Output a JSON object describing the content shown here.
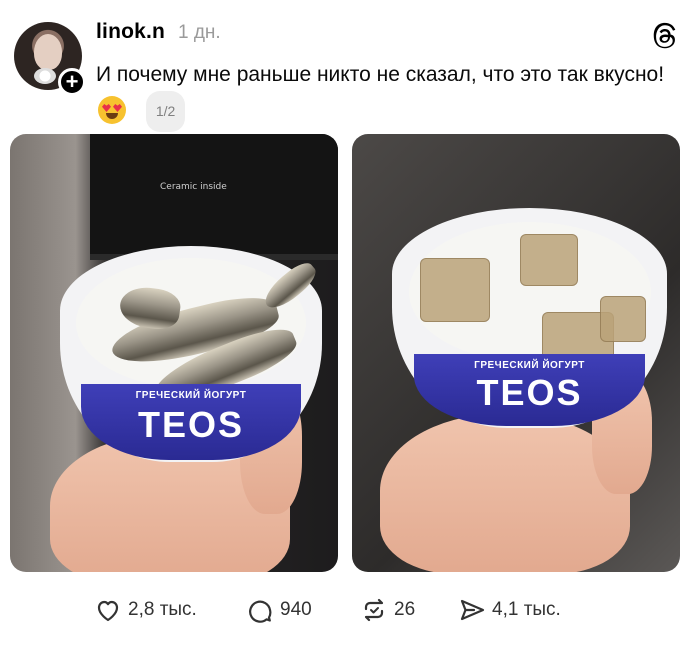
{
  "post": {
    "username": "linok.n",
    "time": "1 дн.",
    "text": "И почему мне раньше никто не сказал, что это так вкусно!",
    "emoji": "smiling-face-with-heart-eyes",
    "pager": "1/2"
  },
  "images": {
    "left": {
      "brand_sub": "ГРЕЧЕСКИЙ ЙОГУРТ",
      "brand": "TEOS",
      "oven_label": "Ceramic inside"
    },
    "right": {
      "brand_sub": "ГРЕЧЕСКИЙ ЙОГУРТ",
      "brand": "TEOS"
    }
  },
  "actions": {
    "likes": "2,8 тыс.",
    "comments": "940",
    "reposts": "26",
    "shares": "4,1 тыс."
  },
  "colors": {
    "cup_band": "#2f2fa3",
    "text_muted": "#9a9a9a",
    "emoji": "#f7c22f"
  }
}
